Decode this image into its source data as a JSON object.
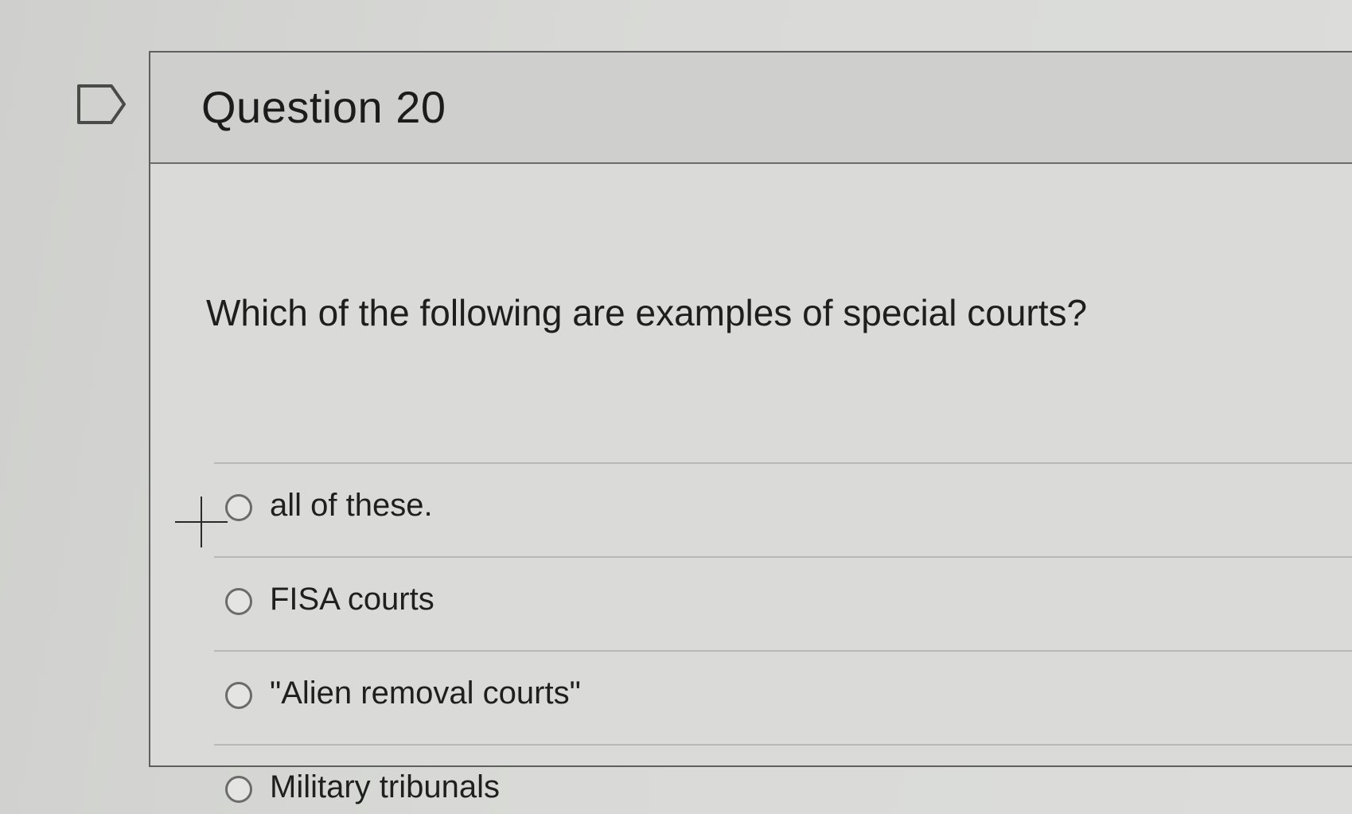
{
  "question": {
    "title": "Question 20",
    "prompt": "Which of the following are examples of special courts?",
    "answers": [
      {
        "label": "all of these."
      },
      {
        "label": "FISA courts"
      },
      {
        "label": "\"Alien removal courts\""
      },
      {
        "label": "Military tribunals"
      }
    ]
  },
  "icons": {
    "flag": "flag-outline-icon",
    "cursor": "crosshair-cursor-icon"
  },
  "colors": {
    "background": "#d6d7d4",
    "border": "#5f605e",
    "text": "#1c1c1c"
  }
}
